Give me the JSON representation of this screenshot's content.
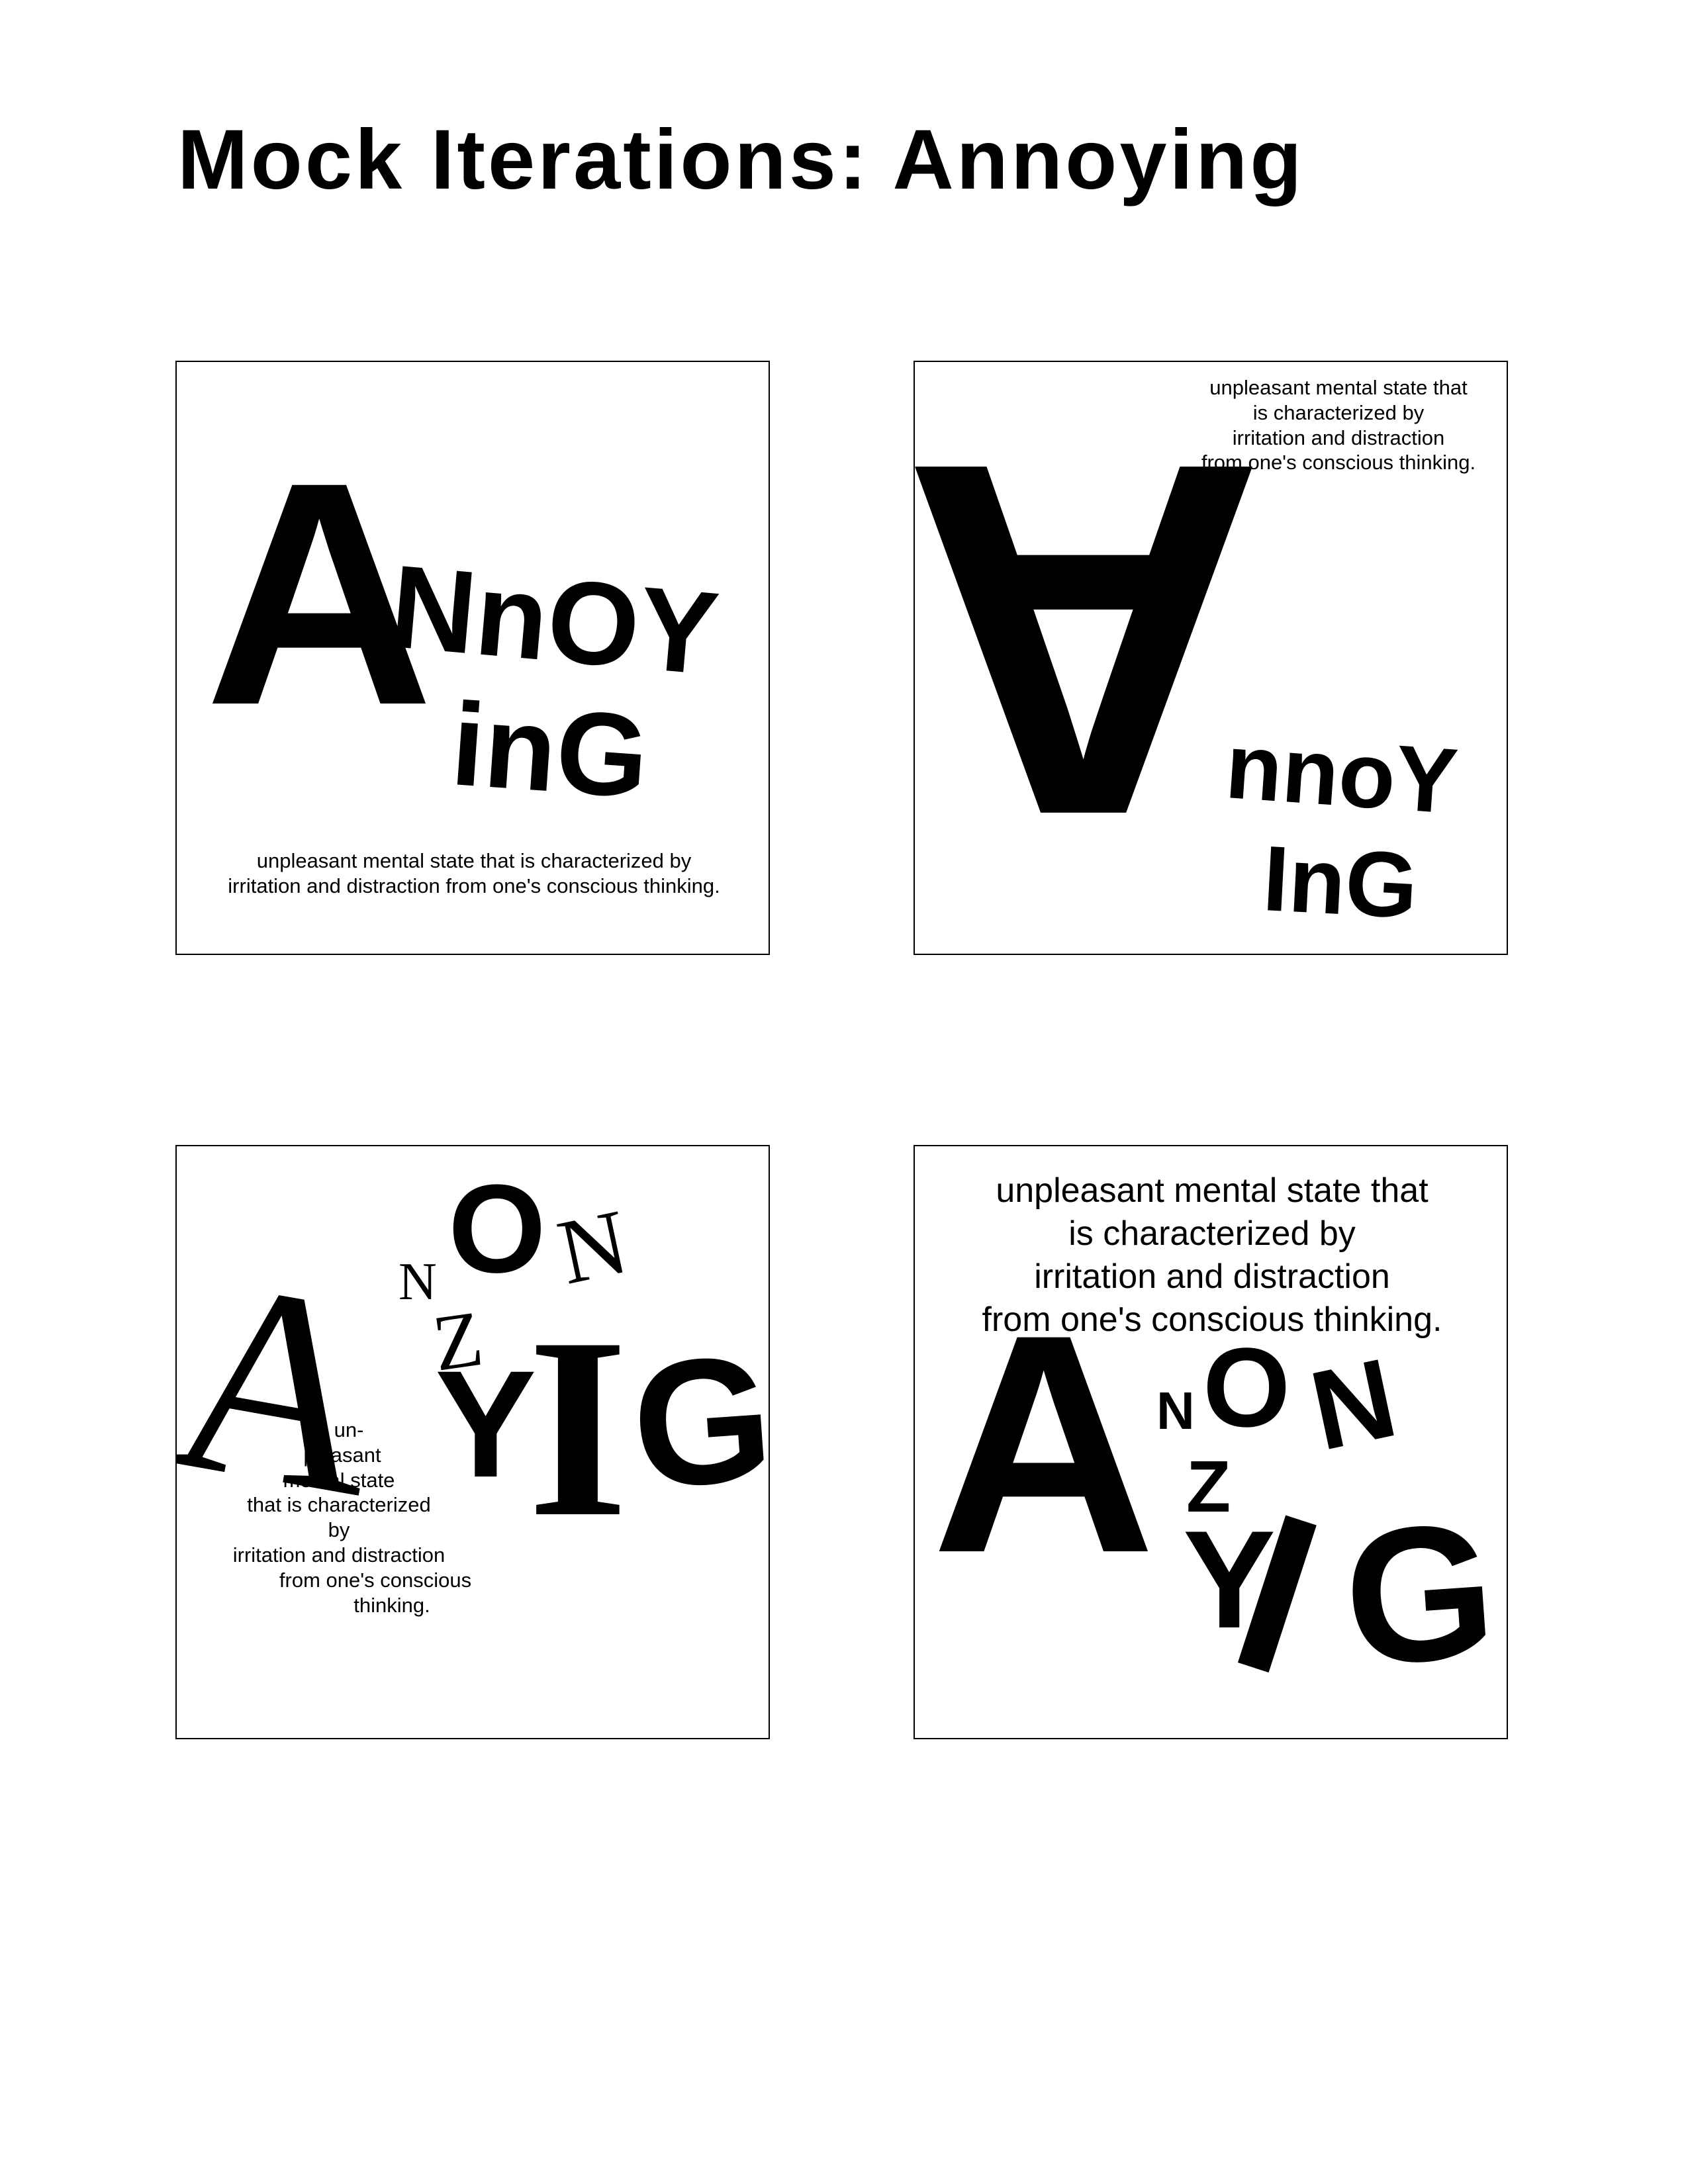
{
  "page": {
    "title": "Mock Iterations: Annoying"
  },
  "panel1": {
    "big_letter": "A",
    "word_rest": "NnOY",
    "word_end": "inG",
    "definition": [
      "unpleasant mental state that is characterized by",
      "irritation and distraction from one's conscious thinking."
    ]
  },
  "panel2": {
    "definition": [
      "unpleasant mental state that",
      "is characterized by",
      "irritation and distraction",
      "from one's conscious thinking."
    ],
    "big_letter": "A",
    "word_rest": "nnoY",
    "word_end": "InG"
  },
  "panel3": {
    "letters": {
      "a": "A",
      "n1": "N",
      "o": "O",
      "n2": "N",
      "z": "Z",
      "y": "Y",
      "i": "I",
      "g": "G"
    },
    "definition": [
      "un-",
      "pleasant",
      "mental state",
      "that is characterized",
      "by",
      "irritation and distraction",
      "from one's conscious",
      "thinking."
    ]
  },
  "panel4": {
    "definition": [
      "unpleasant mental state that",
      "is characterized by",
      "irritation and distraction",
      "from one's conscious thinking."
    ],
    "letters": {
      "a": "A",
      "n1": "N",
      "o": "O",
      "n2": "N",
      "z": "Z",
      "y": "Y",
      "i": "I",
      "g": "G"
    }
  }
}
